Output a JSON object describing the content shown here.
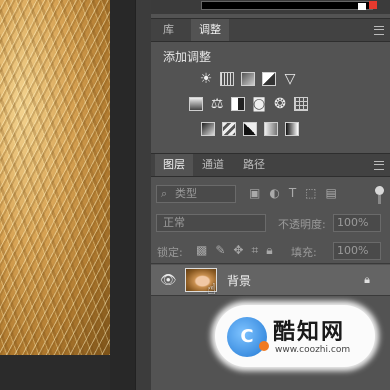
{
  "panels": {
    "top_tabs": [
      {
        "label": "库",
        "active": false
      },
      {
        "label": "调整",
        "active": true
      }
    ],
    "adjustments": {
      "title": "添加调整",
      "icons_row1": [
        "brightness-icon",
        "levels-icon",
        "curves-icon",
        "exposure-icon",
        "vibrance-icon"
      ],
      "icons_row2": [
        "hue-saturation-icon",
        "color-balance-icon",
        "black-white-icon",
        "photo-filter-icon",
        "channel-mixer-icon",
        "color-lookup-icon"
      ],
      "icons_row3": [
        "invert-icon",
        "posterize-icon",
        "threshold-icon",
        "selective-color-icon",
        "gradient-map-icon"
      ]
    },
    "layer_tabs": [
      {
        "label": "图层",
        "active": true
      },
      {
        "label": "通道",
        "active": false
      },
      {
        "label": "路径",
        "active": false
      }
    ],
    "filter": {
      "label": "类型"
    },
    "blend_mode": "正常",
    "opacity_label": "不透明度:",
    "opacity_value": "100%",
    "lock_label": "锁定:",
    "fill_label": "填充:",
    "fill_value": "100%",
    "layers": [
      {
        "name": "背景",
        "visible": true,
        "locked": true
      }
    ]
  },
  "watermark": {
    "title": "酷知网",
    "url": "www.coozhi.com",
    "logo": "C"
  },
  "colors": {
    "panel_bg": "#535353",
    "selected_layer": "#646464",
    "accent_red": "#e53a2e"
  }
}
